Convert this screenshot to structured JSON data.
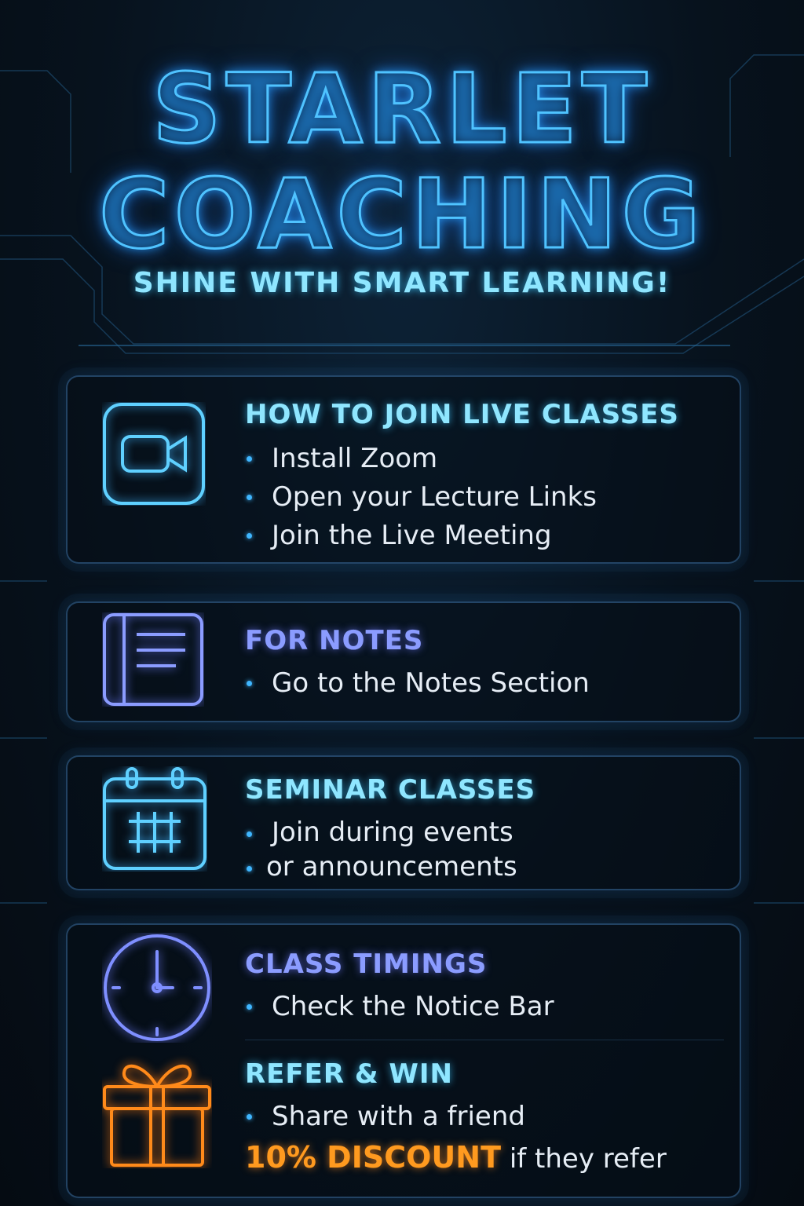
{
  "header": {
    "title_line1": "STARLET",
    "title_line2": "COACHING",
    "tagline": "SHINE WITH SMART LEARNING!"
  },
  "sections": [
    {
      "title": "HOW TO JOIN LIVE CLASSES",
      "icon": "video-camera-icon",
      "items": [
        "Install Zoom",
        "Open your Lecture Links",
        "Join the Live Meeting"
      ]
    },
    {
      "title": "FOR NOTES",
      "icon": "notebook-icon",
      "items": [
        "Go to the Notes Section"
      ]
    },
    {
      "title": "SEMINAR CLASSES",
      "icon": "calendar-icon",
      "items": [
        "Join during events",
        "or announcements"
      ]
    },
    {
      "title": "CLASS TIMINGS",
      "icon": "clock-icon",
      "items": [
        "Check the Notice  Bar"
      ]
    },
    {
      "title": "REFER & WIN",
      "icon": "gift-icon",
      "items": [
        "Share with a friend"
      ],
      "discount": "10% DISCOUNT",
      "discount_suffix": "if they refer"
    }
  ],
  "colors": {
    "background": "#07121d",
    "neon_blue": "#4fc3ff",
    "cyan_heading": "#8fe6ff",
    "violet_heading": "#8b9cff",
    "orange_accent": "#ff9a1f",
    "body_text": "#e6edf5"
  }
}
